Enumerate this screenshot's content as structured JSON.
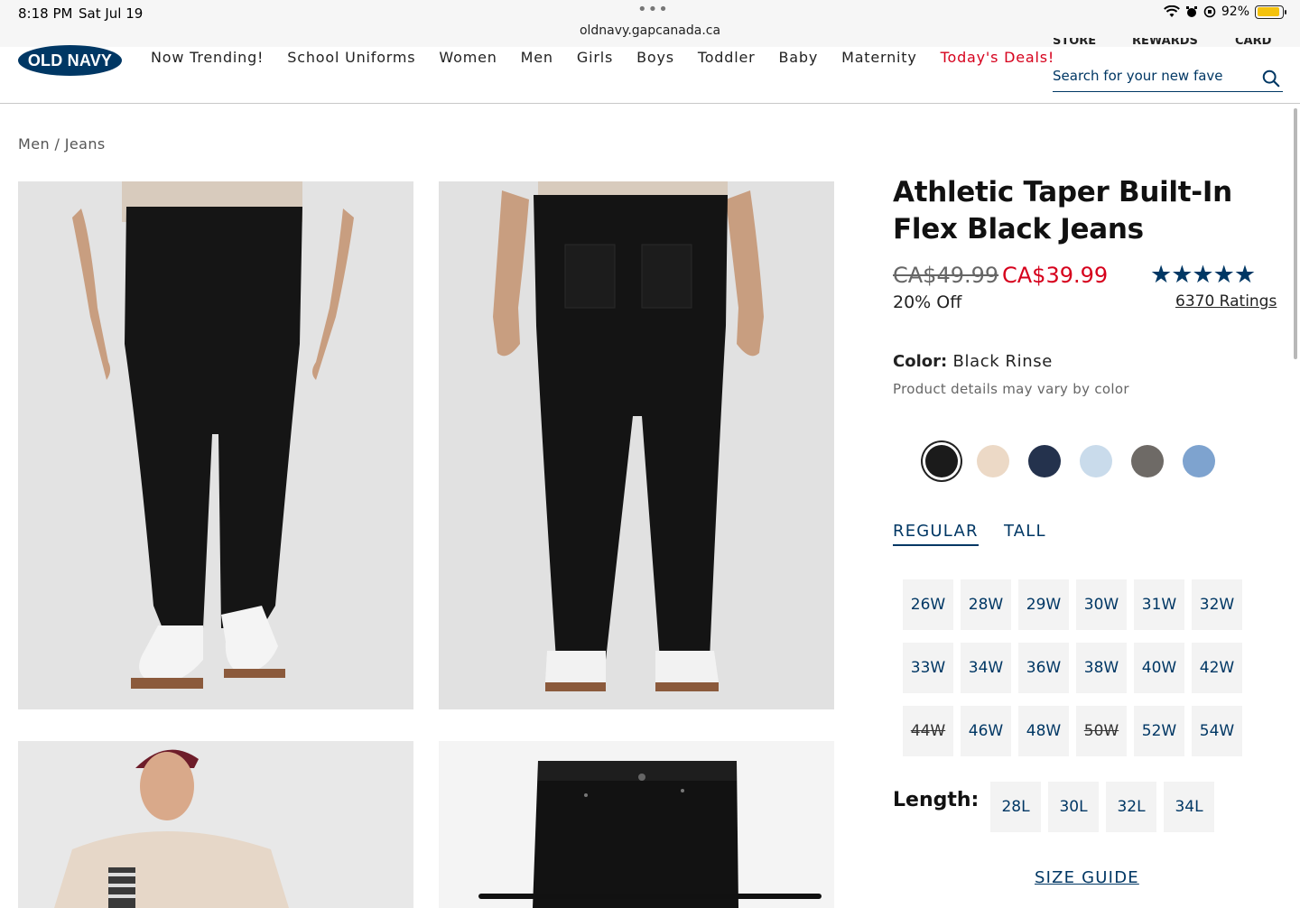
{
  "status_bar": {
    "time": "8:18 PM",
    "date": "Sat Jul 19",
    "url": "oldnavy.gapcanada.ca",
    "battery": "92%",
    "battery_level": 0.92
  },
  "header": {
    "logo": "OLD NAVY",
    "nav": [
      "Now Trending!",
      "School Uniforms",
      "Women",
      "Men",
      "Girls",
      "Boys",
      "Toddler",
      "Baby",
      "Maternity",
      "Today's Deals!"
    ],
    "top_links": [
      "STORE",
      "REWARDS",
      "CARD"
    ],
    "search_placeholder": "Search for your new fave"
  },
  "breadcrumb": "Men / Jeans",
  "product": {
    "title": "Athletic Taper Built-In Flex Black Jeans",
    "old_price": "CA$49.99",
    "new_price": "CA$39.99",
    "discount": "20% Off",
    "stars": "★★★★★",
    "rating_value": 4.7,
    "ratings": "6370 Ratings",
    "color_label": "Color:",
    "color_value": "Black Rinse",
    "color_note": "Product details may vary by color",
    "swatches": [
      {
        "name": "Black Rinse",
        "color": "#1b1b1b",
        "selected": true
      },
      {
        "name": "beige",
        "color": "#ecd9c6"
      },
      {
        "name": "dark wash",
        "color": "#24324d"
      },
      {
        "name": "light wash",
        "color": "#c9dbeb"
      },
      {
        "name": "grey",
        "color": "#6e6a66"
      },
      {
        "name": "medium wash",
        "color": "#7ea3cf"
      }
    ],
    "fit_tabs": [
      "REGULAR",
      "TALL"
    ],
    "waist_sizes": [
      {
        "label": "26W"
      },
      {
        "label": "28W"
      },
      {
        "label": "29W"
      },
      {
        "label": "30W"
      },
      {
        "label": "31W"
      },
      {
        "label": "32W"
      },
      {
        "label": "33W"
      },
      {
        "label": "34W"
      },
      {
        "label": "36W"
      },
      {
        "label": "38W"
      },
      {
        "label": "40W"
      },
      {
        "label": "42W"
      },
      {
        "label": "44W",
        "unavailable": true
      },
      {
        "label": "46W"
      },
      {
        "label": "48W"
      },
      {
        "label": "50W",
        "unavailable": true
      },
      {
        "label": "52W"
      },
      {
        "label": "54W"
      }
    ],
    "length_label": "Length:",
    "lengths": [
      "28L",
      "30L",
      "32L",
      "34L"
    ],
    "size_guide": "SIZE GUIDE"
  }
}
